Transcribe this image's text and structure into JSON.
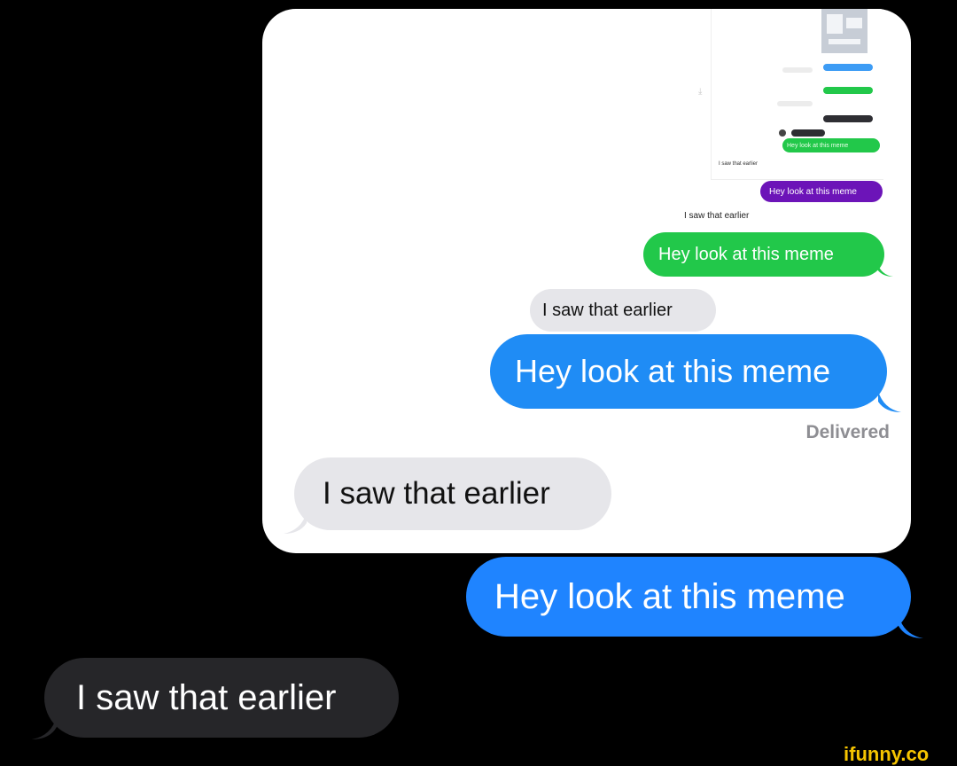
{
  "outer": {
    "received": "I saw that earlier",
    "sent": "Hey look at this meme"
  },
  "screenshot": {
    "received_large": "I saw that earlier",
    "sent_large": "Hey look at this meme",
    "status": "Delivered",
    "received_medium": "I saw that earlier",
    "sent_green": "Hey look at this meme",
    "received_small": "I saw that earlier",
    "sent_purple": "Hey look at this meme",
    "nested": {
      "sent_green_tiny": "Hey look at this meme",
      "received_tiny": "I saw that earlier"
    }
  },
  "watermark": "ifunny.co",
  "colors": {
    "background": "#000000",
    "imessage_blue": "#1f84ff",
    "sms_green": "#22c84a",
    "dark_bubble": "#262629",
    "light_bubble": "#e6e6ea",
    "purple": "#6c14b8",
    "watermark": "#f5c400"
  }
}
